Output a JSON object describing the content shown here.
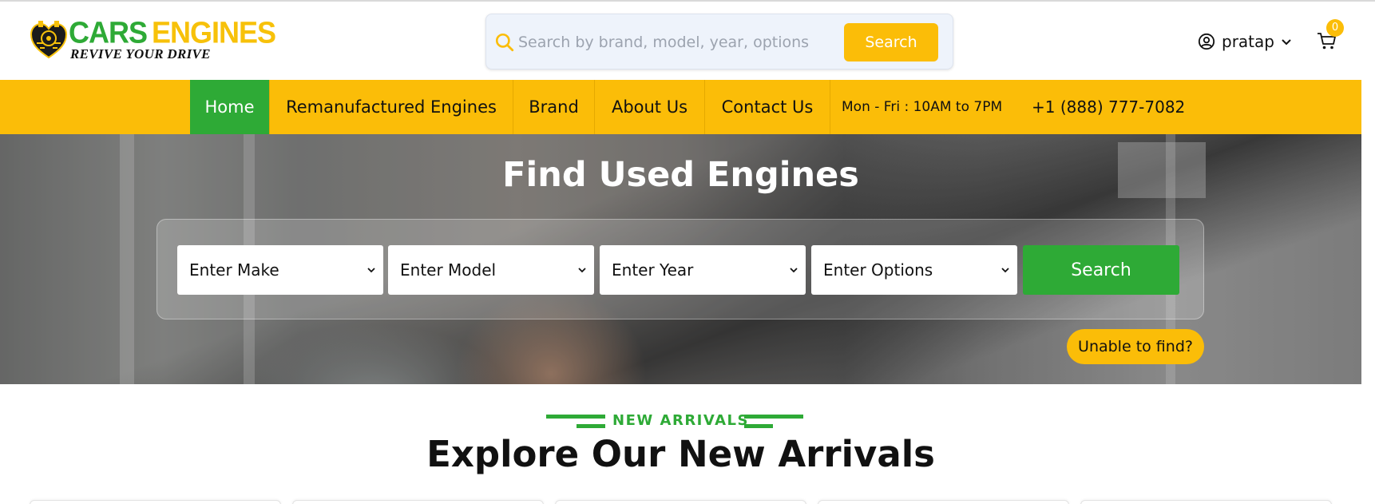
{
  "header": {
    "logo": {
      "title_word1": "CARS",
      "title_word2": "ENGINES",
      "tagline": "REVIVE YOUR DRIVE"
    },
    "search": {
      "placeholder": "Search by brand, model, year, options",
      "button_label": "Search",
      "icon": "search-icon"
    },
    "user": {
      "name": "pratap",
      "icon": "user-circle-icon",
      "dropdown_icon": "chevron-down-icon"
    },
    "cart": {
      "count": "0",
      "icon": "cart-icon"
    }
  },
  "nav": {
    "items": [
      {
        "label": "Home",
        "active": true
      },
      {
        "label": "Remanufactured Engines"
      },
      {
        "label": "Brand"
      },
      {
        "label": "About Us"
      },
      {
        "label": "Contact Us"
      }
    ],
    "hours": "Mon - Fri : 10AM to 7PM",
    "phone": "+1 (888) 777-7082"
  },
  "hero": {
    "title": "Find Used Engines",
    "selects": [
      "Enter Make",
      "Enter Model",
      "Enter Year",
      "Enter Options"
    ],
    "search_label": "Search",
    "unable_label": "Unable to find?"
  },
  "arrivals": {
    "eyebrow": "NEW ARRIVALS",
    "title": "Explore Our New Arrivals"
  },
  "colors": {
    "brand_green": "#2eaa36",
    "brand_yellow": "#fbbd08",
    "search_bg": "#eef3fb"
  }
}
